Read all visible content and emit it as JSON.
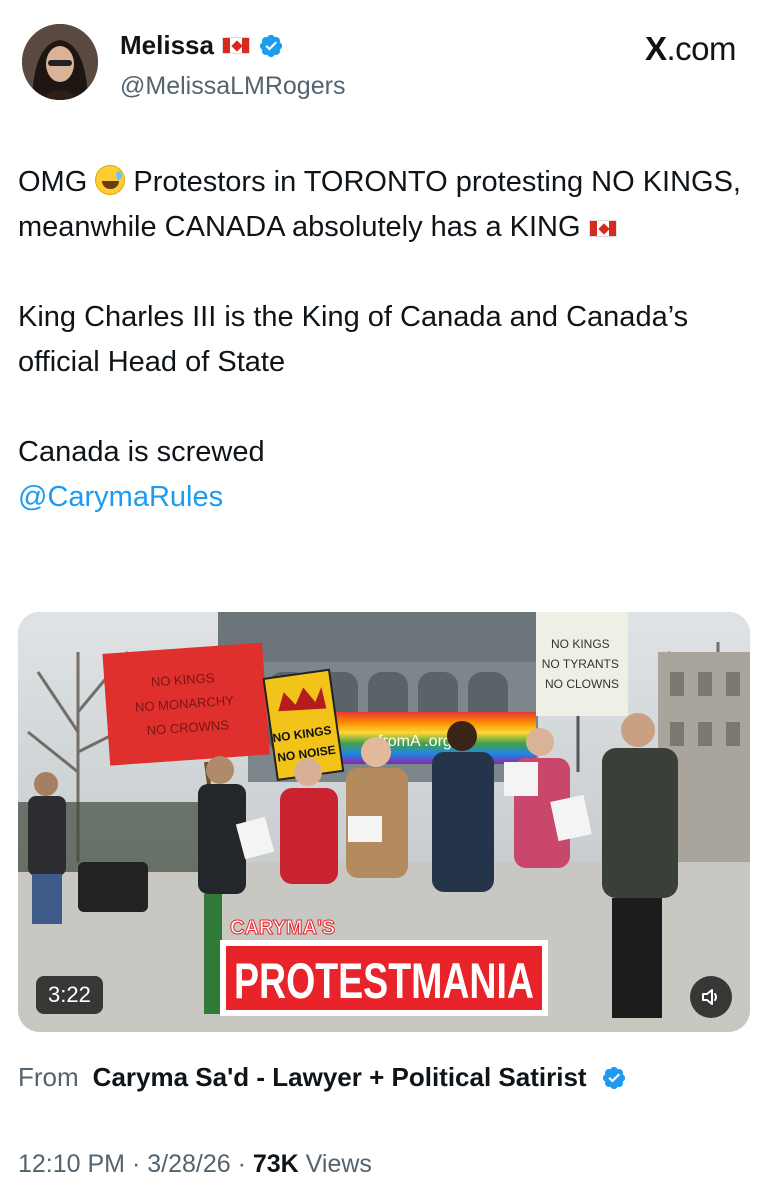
{
  "author": {
    "display_name": "Melissa",
    "handle": "@MelissaLMRogers",
    "flag_icon": "canada-flag-icon",
    "verified_icon": "verified-badge-icon"
  },
  "brand": {
    "logo_text": "X",
    "logo_suffix": ".com"
  },
  "tweet": {
    "line1_pre": "OMG",
    "line1_post": "Protestors in TORONTO protesting NO KINGS, meanwhile CANADA absolutely has a KING",
    "para2": "King Charles III is the King of Canada and Canada’s official Head of State",
    "para3": "Canada is screwed",
    "mention": "@CarymaRules",
    "emoji_icon": "grinning-sweat-emoji-icon"
  },
  "video": {
    "duration": "3:22",
    "overlay_small": "CARYMA'S",
    "overlay_big": "PROTESTMANIA",
    "sign_red_lines": [
      "NO KINGS",
      "NO MONARCHY",
      "NO CROWNS"
    ],
    "sign_yellow": [
      "NO KINGS",
      "NO NOISE"
    ],
    "sign_white": [
      "NO KINGS",
      "NO TYRANTS",
      "NO CLOWNS"
    ],
    "banner_text": "fromA   .org",
    "volume_icon": "volume-icon"
  },
  "source": {
    "from_label": "From",
    "channel_name": "Caryma Sa'd - Lawyer + Political Satirist"
  },
  "meta": {
    "time_date": "12:10 PM · 3/28/26 · ",
    "views_count": "73K",
    "views_label": " Views"
  },
  "colors": {
    "text": "#0f1419",
    "secondary": "#536471",
    "link": "#1d9bf0",
    "verified": "#1d9bf0",
    "overlay_red": "#e8232a"
  }
}
